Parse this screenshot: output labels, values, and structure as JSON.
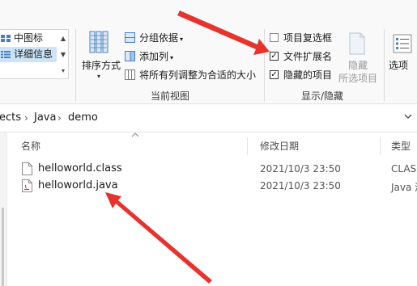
{
  "ribbon": {
    "layout": {
      "items": [
        {
          "label": "中图标",
          "selected": false
        },
        {
          "label": "详细信息",
          "selected": true
        }
      ]
    },
    "current_view": {
      "group_label": "当前视图",
      "sort_label": "排序方式",
      "group_by_label": "分组依据",
      "add_column_label": "添加列",
      "fit_columns_label": "将所有列调整为合适的大小"
    },
    "show_hide": {
      "group_label": "显示/隐藏",
      "checkboxes": [
        {
          "label": "项目复选框",
          "checked": false
        },
        {
          "label": "文件扩展名",
          "checked": true
        },
        {
          "label": "隐藏的项目",
          "checked": true
        }
      ],
      "hide_selected_line1": "隐藏",
      "hide_selected_line2": "所选项目"
    },
    "options_label": "选项"
  },
  "address": {
    "crumbs": [
      "ects",
      "Java",
      "demo"
    ]
  },
  "file_list": {
    "columns": {
      "name": "名称",
      "modified": "修改日期",
      "type": "类型"
    },
    "rows": [
      {
        "name": "helloworld.class",
        "modified": "2021/10/3 23:50",
        "type": "CLASS",
        "icon": "file-icon"
      },
      {
        "name": "helloworld.java",
        "modified": "2021/10/3 23:50",
        "type": "Java 源",
        "icon": "java-file-icon"
      }
    ]
  },
  "annotation_color": "#e8322d"
}
